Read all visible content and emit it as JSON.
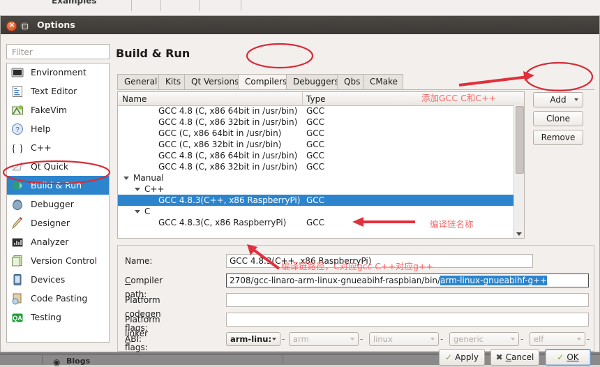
{
  "background_window": {
    "tabs": [
      "Examples"
    ],
    "bottom_item": "Blogs"
  },
  "window": {
    "title": "Options",
    "close_icon": "close-icon",
    "minimize_icon": "minimize-icon"
  },
  "sidebar": {
    "filter_placeholder": "Filter",
    "items": [
      {
        "label": "Environment",
        "icon": "monitor-icon",
        "selected": false
      },
      {
        "label": "Text Editor",
        "icon": "text-editor-icon",
        "selected": false
      },
      {
        "label": "FakeVim",
        "icon": "fakevim-icon",
        "selected": false
      },
      {
        "label": "Help",
        "icon": "help-icon",
        "selected": false
      },
      {
        "label": "C++",
        "icon": "cpp-icon",
        "selected": false
      },
      {
        "label": "Qt Quick",
        "icon": "qtquick-icon",
        "selected": false
      },
      {
        "label": "Build & Run",
        "icon": "build-run-icon",
        "selected": true
      },
      {
        "label": "Debugger",
        "icon": "debugger-icon",
        "selected": false
      },
      {
        "label": "Designer",
        "icon": "designer-icon",
        "selected": false
      },
      {
        "label": "Analyzer",
        "icon": "analyzer-icon",
        "selected": false
      },
      {
        "label": "Version Control",
        "icon": "version-control-icon",
        "selected": false
      },
      {
        "label": "Devices",
        "icon": "devices-icon",
        "selected": false
      },
      {
        "label": "Code Pasting",
        "icon": "code-pasting-icon",
        "selected": false
      },
      {
        "label": "Testing",
        "icon": "testing-icon",
        "selected": false
      }
    ]
  },
  "main": {
    "page_title": "Build & Run",
    "tabs": [
      {
        "label": "General",
        "active": false
      },
      {
        "label": "Kits",
        "active": false
      },
      {
        "label": "Qt Versions",
        "active": false
      },
      {
        "label": "Compilers",
        "active": true
      },
      {
        "label": "Debuggers",
        "active": false
      },
      {
        "label": "Qbs",
        "active": false
      },
      {
        "label": "CMake",
        "active": false
      }
    ],
    "list": {
      "columns": [
        "Name",
        "Type"
      ],
      "rows": [
        {
          "name": "GCC 4.8 (C, x86 64bit in /usr/bin)",
          "type": "GCC",
          "indent": 2,
          "group": false,
          "selected": false
        },
        {
          "name": "GCC 4.8 (C, x86 32bit in /usr/bin)",
          "type": "GCC",
          "indent": 2,
          "group": false,
          "selected": false
        },
        {
          "name": "GCC (C, x86 64bit in /usr/bin)",
          "type": "GCC",
          "indent": 2,
          "group": false,
          "selected": false
        },
        {
          "name": "GCC (C, x86 32bit in /usr/bin)",
          "type": "GCC",
          "indent": 2,
          "group": false,
          "selected": false
        },
        {
          "name": "GCC 4.8 (C, x86 64bit in /usr/bin)",
          "type": "GCC",
          "indent": 2,
          "group": false,
          "selected": false
        },
        {
          "name": "GCC 4.8 (C, x86 32bit in /usr/bin)",
          "type": "GCC",
          "indent": 2,
          "group": false,
          "selected": false
        },
        {
          "name": "Manual",
          "type": "",
          "indent": 0,
          "group": true,
          "selected": false
        },
        {
          "name": "C++",
          "type": "",
          "indent": 1,
          "group": true,
          "selected": false
        },
        {
          "name": "GCC 4.8.3(C++, x86 RaspberryPi)",
          "type": "GCC",
          "indent": 2,
          "group": false,
          "selected": true
        },
        {
          "name": "C",
          "type": "",
          "indent": 1,
          "group": true,
          "selected": false
        },
        {
          "name": "GCC 4.8.3(C, x86 RaspberryPi)",
          "type": "GCC",
          "indent": 2,
          "group": false,
          "selected": false
        }
      ]
    },
    "side_buttons": [
      {
        "label": "Add",
        "has_dropdown": true
      },
      {
        "label": "Clone",
        "has_dropdown": false
      },
      {
        "label": "Remove",
        "has_dropdown": false
      }
    ],
    "form": {
      "name_label": "Name:",
      "name_value": "GCC 4.8.3(C++, x86 RaspberryPi)",
      "compiler_path_label": "Compiler path:",
      "compiler_path_value_plain": "2708/gcc-linaro-arm-linux-gnueabihf-raspbian/bin/",
      "compiler_path_value_selected": "arm-linux-gnueabihf-g++",
      "platform_codegen_label": "Platform codegen flags:",
      "platform_codegen_value": "",
      "platform_linker_label": "Platform linker flags:",
      "platform_linker_value": "",
      "abi_label": "ABI:",
      "abi_values": [
        "arm-linu:",
        "arm",
        "linux",
        "generic",
        "elf"
      ],
      "abi_separator": "-"
    }
  },
  "dialog_buttons": [
    {
      "label": "Apply",
      "icon": "check-icon"
    },
    {
      "label": "Cancel",
      "icon": "cross-icon"
    },
    {
      "label": "OK",
      "icon": "check-icon",
      "default": true
    }
  ],
  "annotations": [
    {
      "id": "anno-add-gcc",
      "text": "添加GCC C和C++"
    },
    {
      "id": "anno-name",
      "text": "编译链名称"
    },
    {
      "id": "anno-path",
      "text": "编译链路径，C对应gcc    C++对应g++"
    }
  ],
  "colors": {
    "selection_blue": "#2c84cc",
    "annotation_red": "#f46b6b",
    "titlebar": "#413d3a",
    "window_bg": "#f2efec"
  }
}
